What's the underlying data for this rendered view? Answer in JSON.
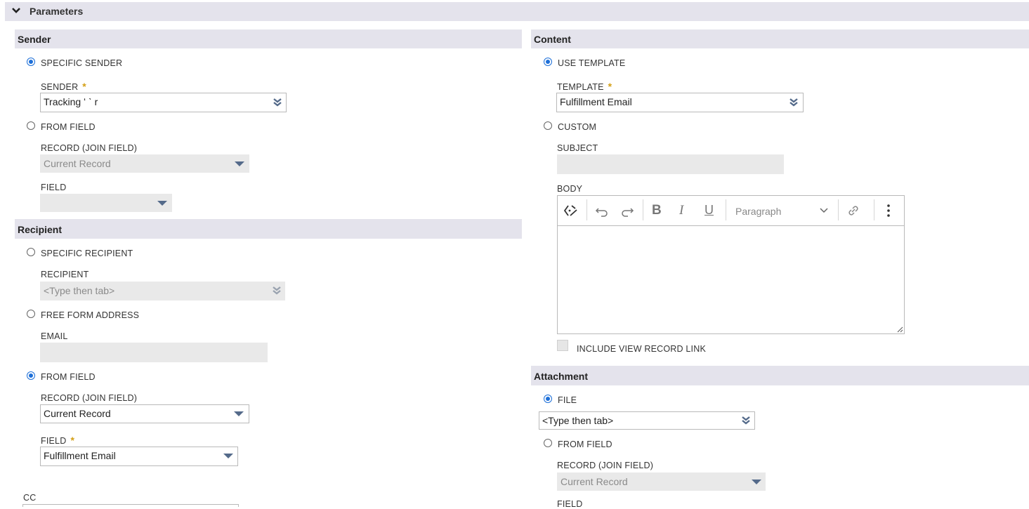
{
  "panel": {
    "title": "Parameters"
  },
  "sender": {
    "title": "Sender",
    "specific_sender": "SPECIFIC SENDER",
    "sender_label": "SENDER",
    "required_mark": "*",
    "sender_value": "Tracking ʻ ˋ r",
    "from_field": "FROM FIELD",
    "record_label": "RECORD (JOIN FIELD)",
    "record_value": "Current Record",
    "field_label": "FIELD",
    "field_value": ""
  },
  "recipient": {
    "title": "Recipient",
    "specific_recipient": "SPECIFIC RECIPIENT",
    "recipient_label": "RECIPIENT",
    "recipient_placeholder": "<Type then tab>",
    "free_form": "FREE FORM ADDRESS",
    "email_label": "EMAIL",
    "email_value": "",
    "from_field": "FROM FIELD",
    "record_label": "RECORD (JOIN FIELD)",
    "record_value": "Current Record",
    "field_label": "FIELD",
    "required_mark": "*",
    "field_value": "Fulfillment Email",
    "cc_label": "CC"
  },
  "content": {
    "title": "Content",
    "use_template": "USE TEMPLATE",
    "template_label": "TEMPLATE",
    "required_mark": "*",
    "template_value": "Fulfillment Email",
    "custom": "CUSTOM",
    "subject_label": "SUBJECT",
    "subject_value": "",
    "body_label": "BODY",
    "paragraph_select": "Paragraph",
    "include_link": "INCLUDE VIEW RECORD LINK"
  },
  "attachment": {
    "title": "Attachment",
    "file": "FILE",
    "file_placeholder": "<Type then tab>",
    "from_field": "FROM FIELD",
    "record_label": "RECORD (JOIN FIELD)",
    "record_value": "Current Record",
    "field_label": "FIELD"
  },
  "colors": {
    "accent": "#1d6fd8",
    "section_bg": "#e4e3ec",
    "required": "#d4a017",
    "dropdown_icon": "#546a8a"
  }
}
